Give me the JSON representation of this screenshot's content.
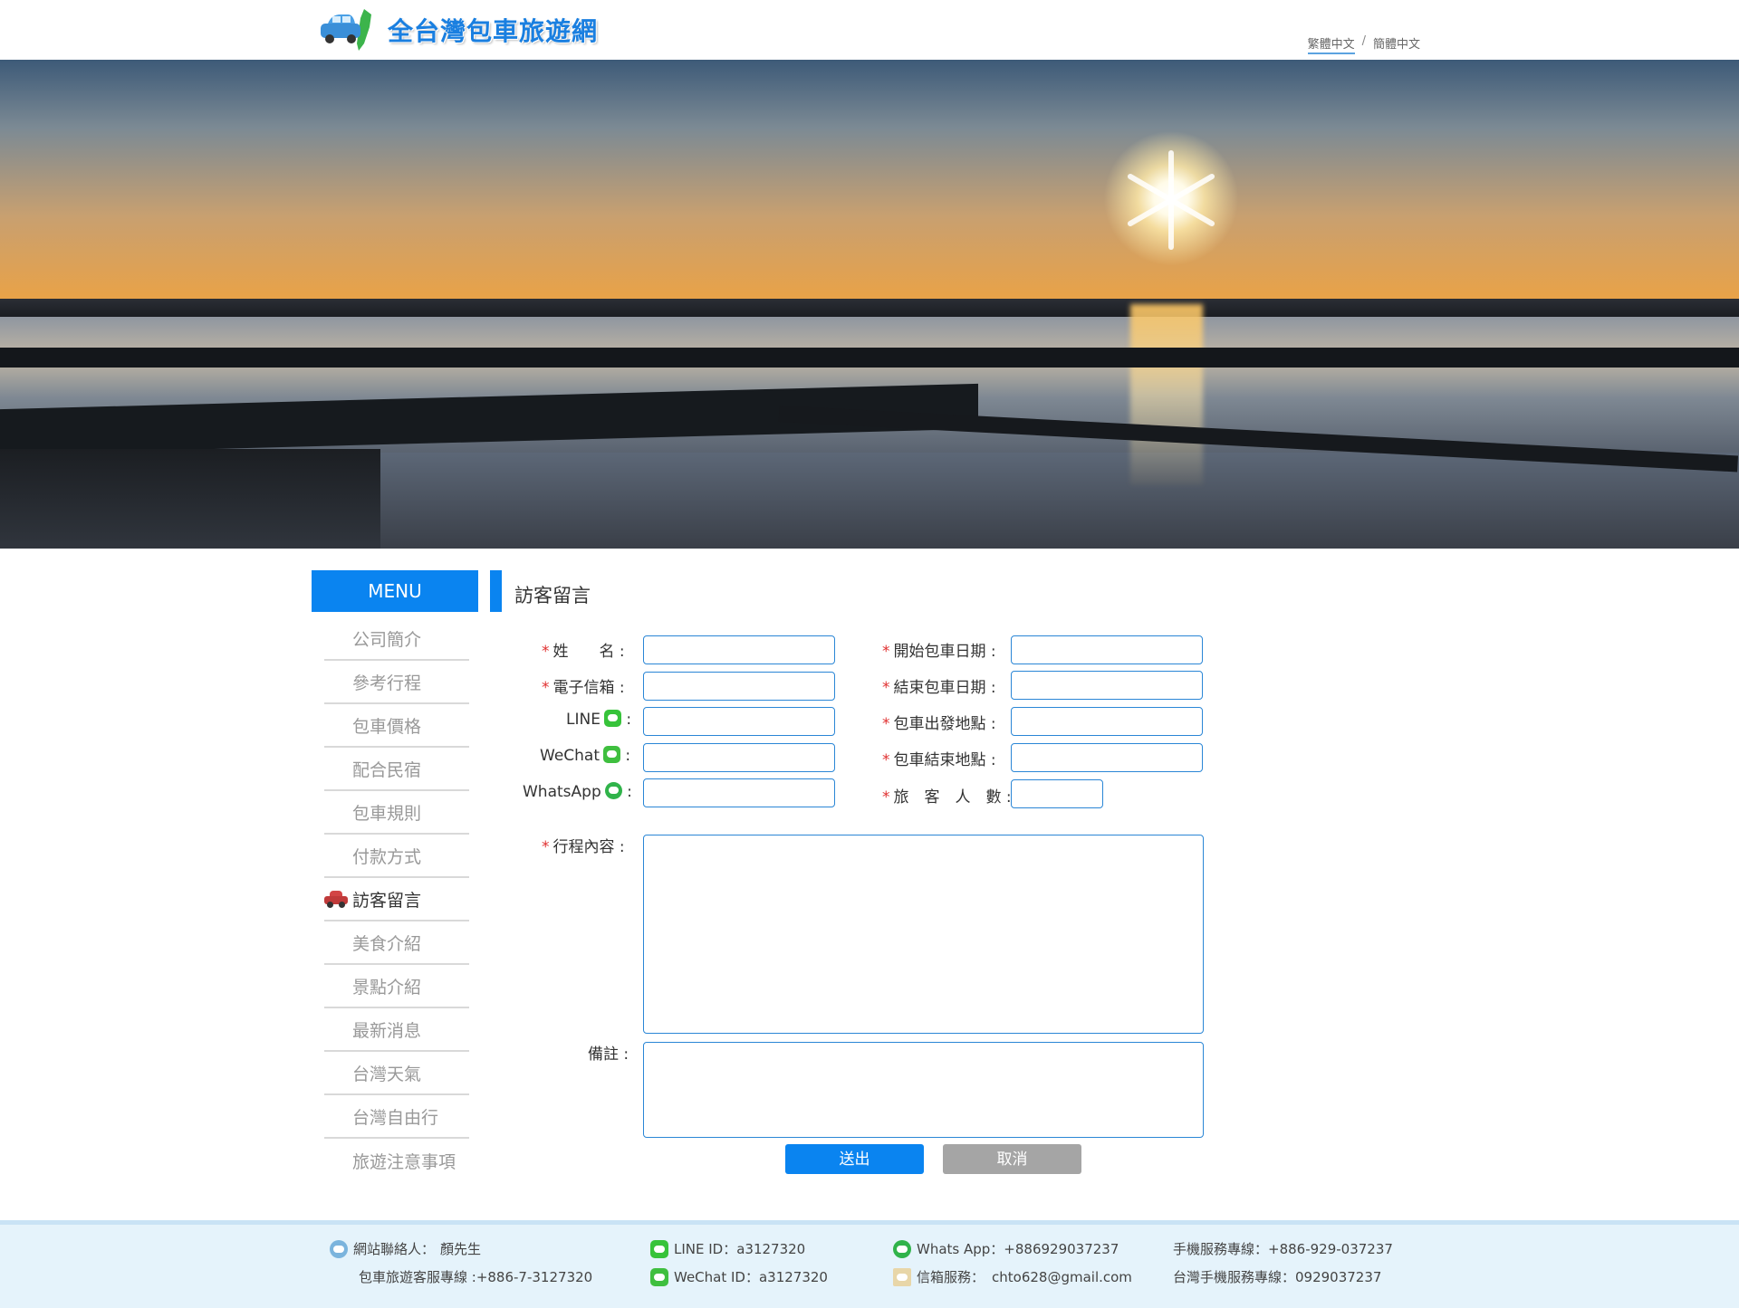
{
  "header": {
    "site_title": "全台灣包車旅遊網",
    "lang_traditional": "繁體中文",
    "lang_separator": "/",
    "lang_simplified": "簡體中文"
  },
  "banner": {
    "slides": 5,
    "active_slide": 3
  },
  "sidebar": {
    "menu_title": "MENU",
    "items": [
      {
        "label": "公司簡介"
      },
      {
        "label": "參考行程"
      },
      {
        "label": "包車價格"
      },
      {
        "label": "配合民宿"
      },
      {
        "label": "包車規則"
      },
      {
        "label": "付款方式"
      },
      {
        "label": "訪客留言",
        "active": true
      },
      {
        "label": "美食介紹"
      },
      {
        "label": "景點介紹"
      },
      {
        "label": "最新消息"
      },
      {
        "label": "台灣天氣"
      },
      {
        "label": "台灣自由行"
      },
      {
        "label": "旅遊注意事項"
      }
    ]
  },
  "content": {
    "section_title": "訪客留言",
    "required_mark": "*",
    "colon": ":",
    "labels": {
      "name": "姓　　名",
      "email": "電子信箱",
      "line": "LINE",
      "wechat": "WeChat",
      "whatsapp": "WhatsApp",
      "start_date": "開始包車日期",
      "end_date": "結束包車日期",
      "departure": "包車出發地點",
      "end_place": "包車結束地點",
      "travelers": "旅　客　人　數",
      "itinerary": "行程內容",
      "notes": "備註"
    },
    "buttons": {
      "submit": "送出",
      "cancel": "取消"
    }
  },
  "footer": {
    "contact_label": "網站聯絡人：",
    "contact_name": "顏先生",
    "hotline": "包車旅遊客服專線 :+886-7-3127320",
    "line_id": "LINE ID：a3127320",
    "wechat_id": "WeChat ID：a3127320",
    "whatsapp": "Whats App：+886929037237",
    "email_label": "信箱服務：",
    "email": "chto628@gmail.com",
    "mobile_hotline": "手機服務專線：+886-929-037237",
    "taiwan_mobile": "台灣手機服務專線：0929037237"
  },
  "colors": {
    "accent": "#0a84f0",
    "cancel": "#a5a5a5",
    "required": "#e03030",
    "footer_bg": "#e5f3fb"
  }
}
